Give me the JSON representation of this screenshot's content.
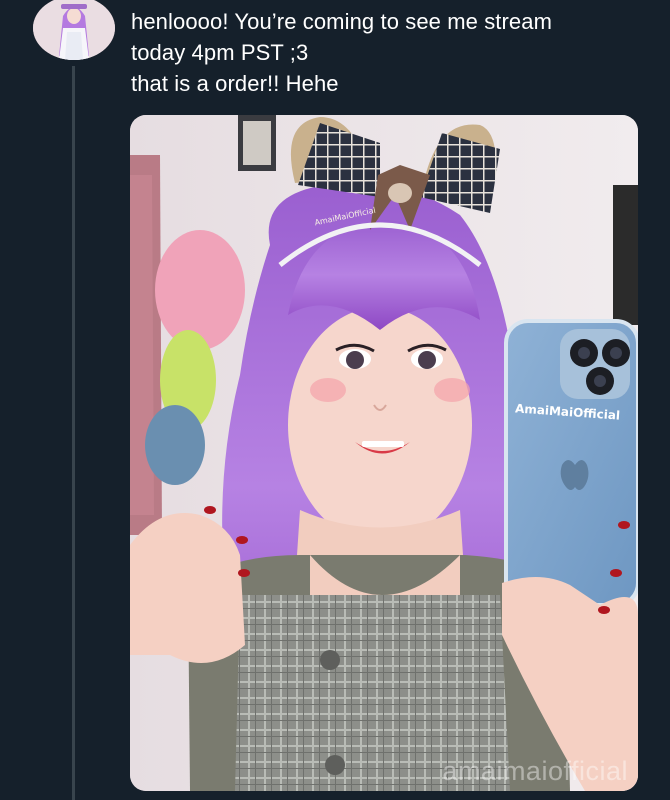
{
  "tweet": {
    "lines": [
      "henloooo! You’re coming to see me stream",
      "today 4pm PST ;3",
      "that is a order!! Hehe"
    ]
  },
  "media": {
    "headband_text": "AmaiMaiOfficial",
    "phone_case_text": "AmaiMaiOfficial",
    "watermark": "amaimaiofficial"
  },
  "colors": {
    "background": "#15202b",
    "thread_line": "#38444d",
    "text": "#ffffff",
    "hair": "#b27ae0"
  }
}
